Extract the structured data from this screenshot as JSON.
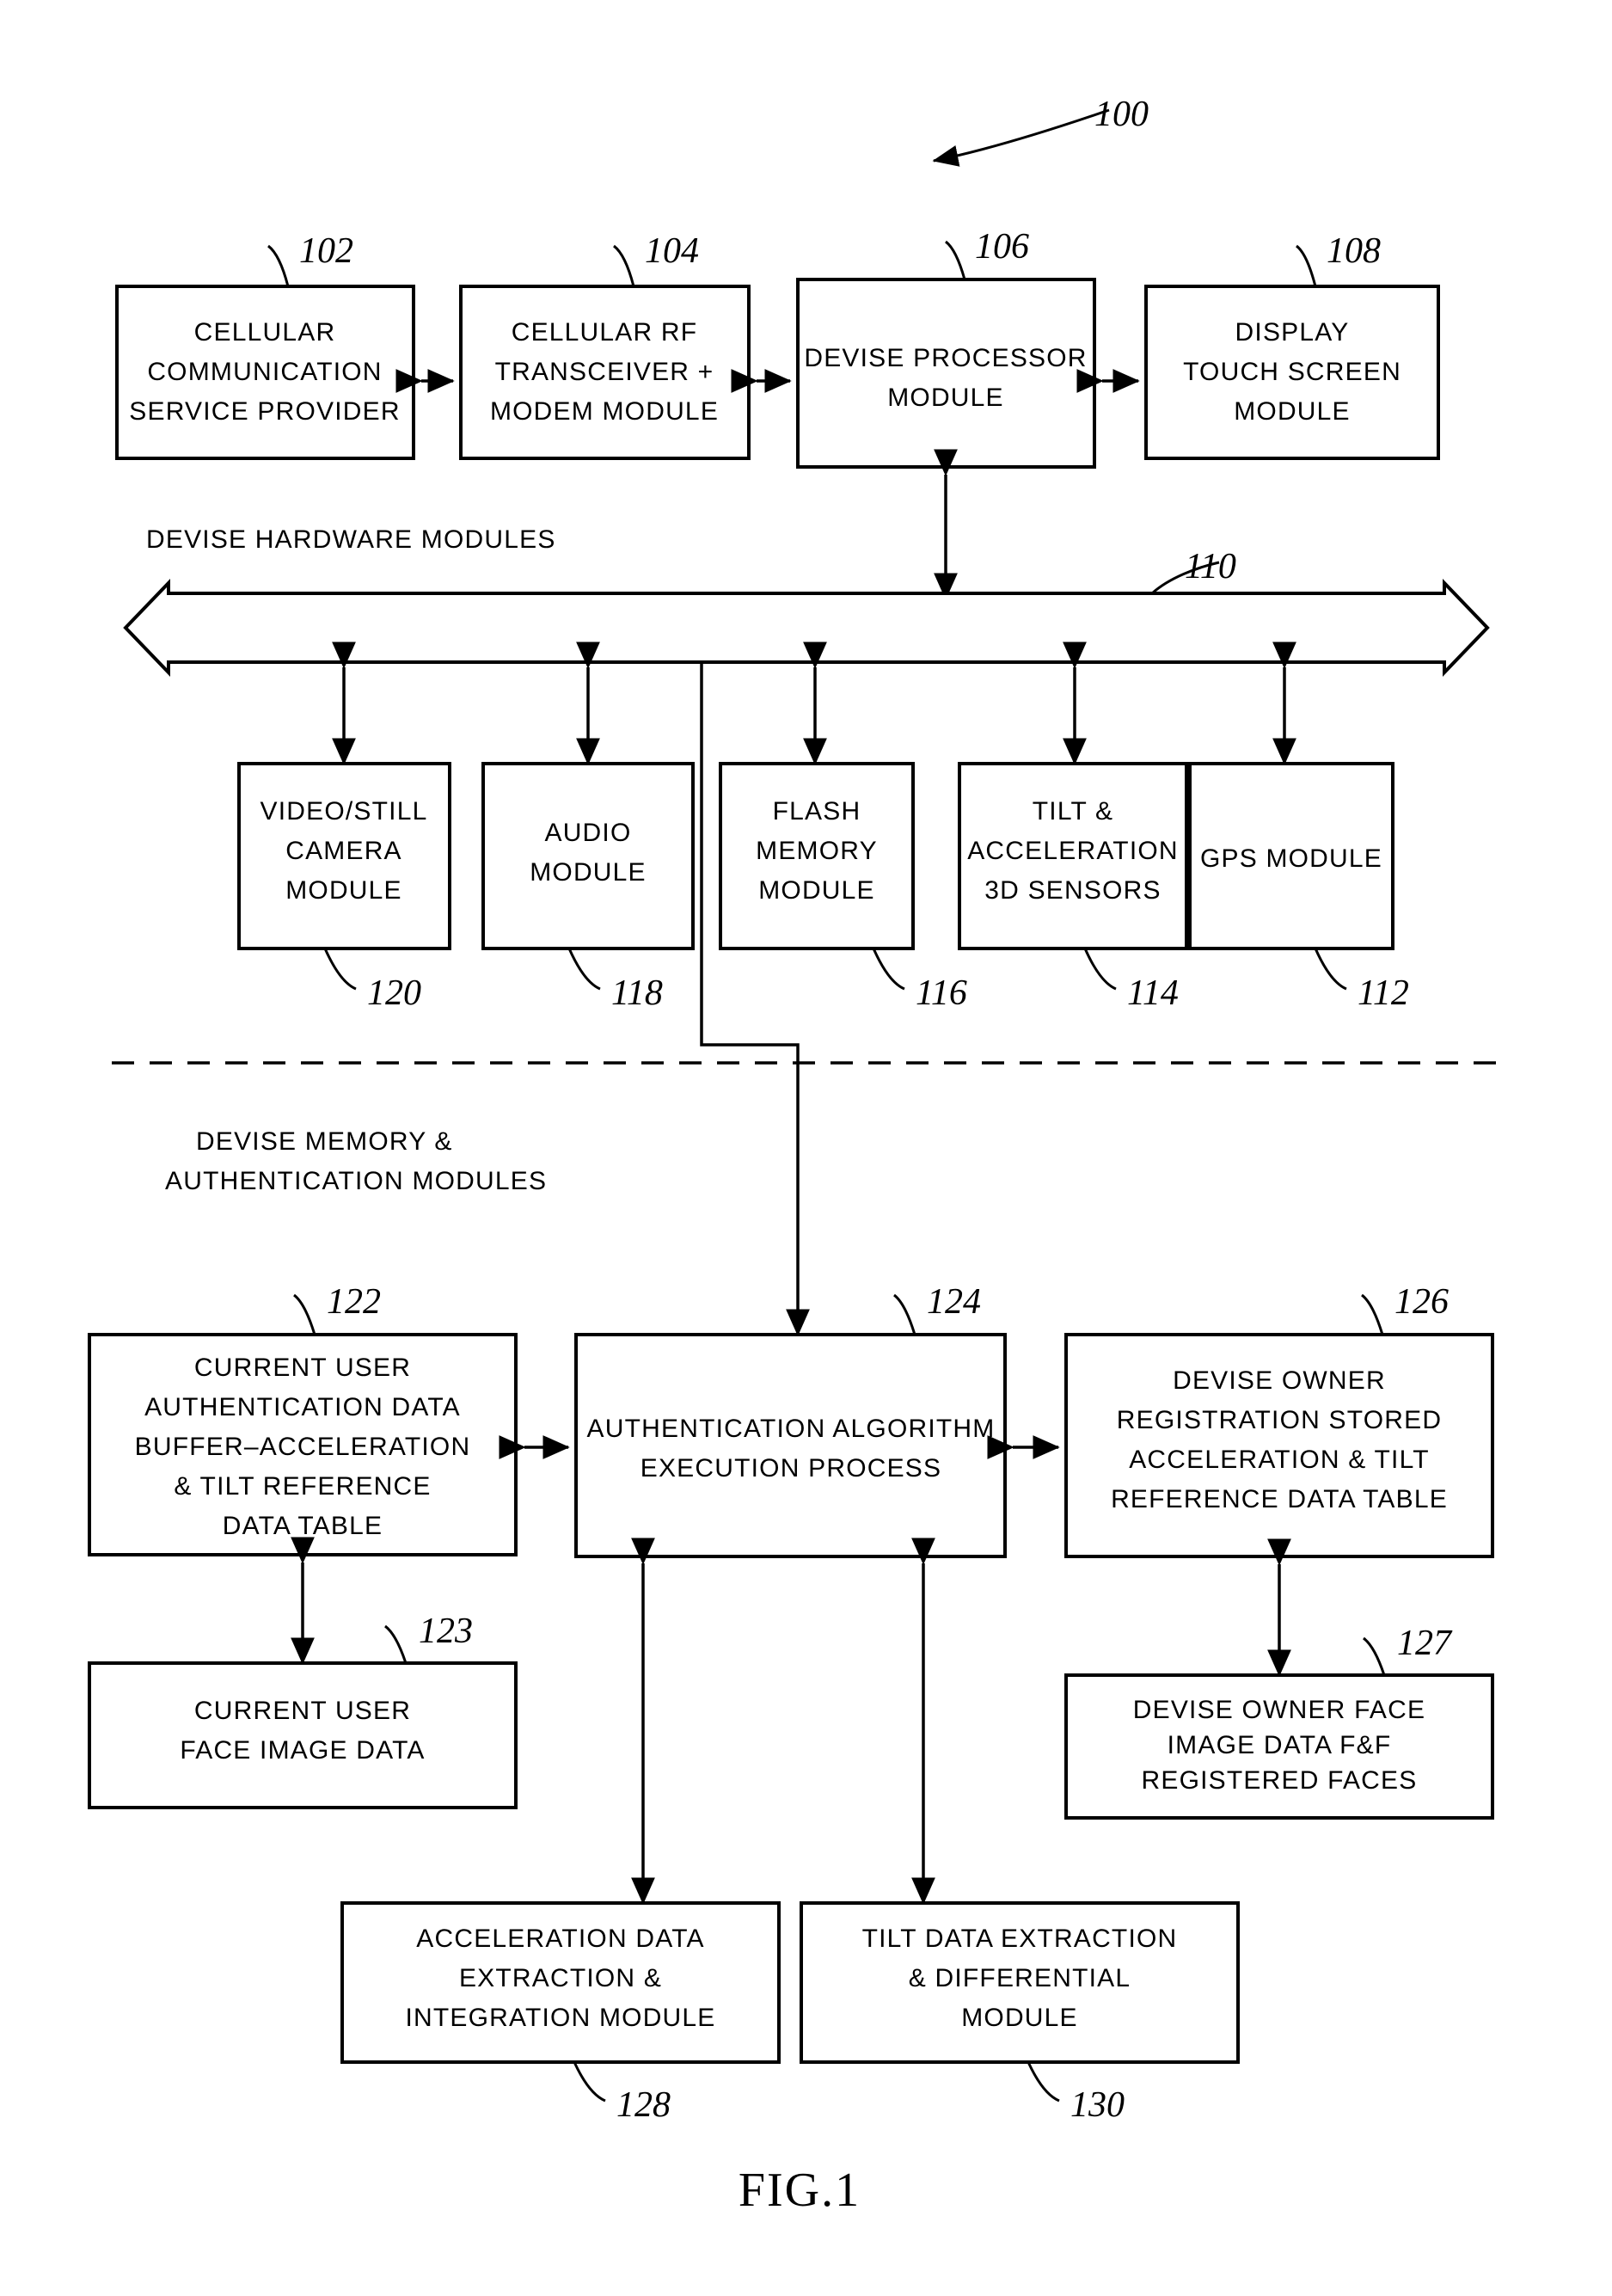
{
  "figure": {
    "caption": "FIG.1",
    "system_ref": "100"
  },
  "sections": {
    "hardware_label": "DEVISE HARDWARE MODULES",
    "memory_label_line1": "DEVISE MEMORY &",
    "memory_label_line2": "AUTHENTICATION MODULES"
  },
  "bus": {
    "ref": "110"
  },
  "top_row": [
    {
      "ref": "102",
      "lines": [
        "CELLULAR",
        "COMMUNICATION",
        "SERVICE PROVIDER"
      ]
    },
    {
      "ref": "104",
      "lines": [
        "CELLULAR RF",
        "TRANSCEIVER +",
        "MODEM MODULE"
      ]
    },
    {
      "ref": "106",
      "lines": [
        "DEVISE PROCESSOR",
        "MODULE"
      ]
    },
    {
      "ref": "108",
      "lines": [
        "DISPLAY",
        "TOUCH SCREEN",
        "MODULE"
      ]
    }
  ],
  "sensor_row": [
    {
      "ref": "120",
      "lines": [
        "VIDEO/STILL",
        "CAMERA",
        "MODULE"
      ]
    },
    {
      "ref": "118",
      "lines": [
        "AUDIO",
        "MODULE"
      ]
    },
    {
      "ref": "116",
      "lines": [
        "FLASH",
        "MEMORY",
        "MODULE"
      ]
    },
    {
      "ref": "114",
      "lines": [
        "TILT &",
        "ACCELERATION",
        "3D SENSORS"
      ]
    },
    {
      "ref": "112",
      "lines": [
        "GPS MODULE"
      ]
    }
  ],
  "auth_row": [
    {
      "ref": "122",
      "lines": [
        "CURRENT USER",
        "AUTHENTICATION DATA",
        "BUFFER–ACCELERATION",
        "& TILT REFERENCE",
        "DATA TABLE"
      ]
    },
    {
      "ref": "124",
      "lines": [
        "AUTHENTICATION ALGORITHM",
        "EXECUTION PROCESS"
      ]
    },
    {
      "ref": "126",
      "lines": [
        "DEVISE OWNER",
        "REGISTRATION STORED",
        "ACCELERATION & TILT",
        "REFERENCE DATA TABLE"
      ]
    }
  ],
  "face_row": [
    {
      "ref": "123",
      "lines": [
        "CURRENT USER",
        "FACE IMAGE DATA"
      ]
    },
    {
      "ref": "127",
      "lines": [
        "DEVISE OWNER FACE",
        "IMAGE DATA F&F",
        "REGISTERED FACES"
      ]
    }
  ],
  "bottom_row": [
    {
      "ref": "128",
      "lines": [
        "ACCELERATION DATA",
        "EXTRACTION &",
        "INTEGRATION MODULE"
      ]
    },
    {
      "ref": "130",
      "lines": [
        "TILT DATA EXTRACTION",
        "& DIFFERENTIAL",
        "MODULE"
      ]
    }
  ],
  "colors": {
    "ink": "#000000",
    "paper": "#ffffff"
  }
}
